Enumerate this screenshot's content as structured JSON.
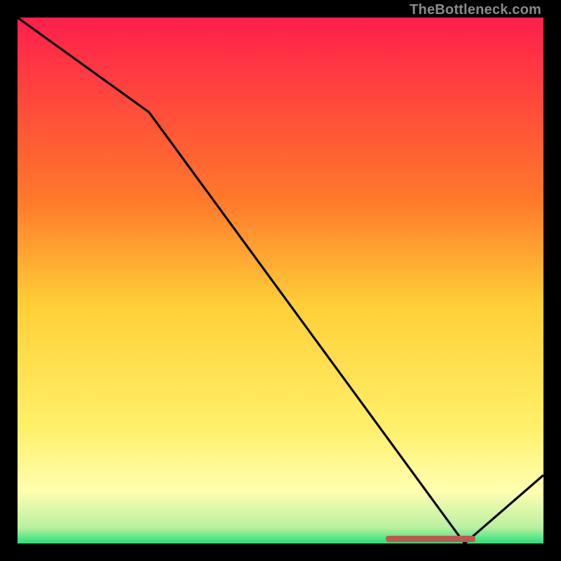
{
  "watermark": "TheBottleneck.com",
  "colors": {
    "bg": "#000000",
    "grad_top": "#ff1f4b",
    "grad_mid_upper": "#ff7a2a",
    "grad_mid": "#ffd038",
    "grad_mid_lower": "#fff06a",
    "grad_pale": "#ffffb0",
    "grad_green": "#28e07a",
    "curve": "#000000",
    "marker": "#c1584e"
  },
  "chart_data": {
    "type": "line",
    "title": "",
    "xlabel": "",
    "ylabel": "",
    "xlim": [
      0,
      100
    ],
    "ylim": [
      0,
      100
    ],
    "x": [
      0,
      25,
      85,
      100
    ],
    "values": [
      100,
      82,
      0,
      13
    ],
    "optimal_range_x": [
      70,
      87
    ],
    "gradient_stops": [
      {
        "pos": 0.0,
        "color": "#ff1f4b"
      },
      {
        "pos": 0.35,
        "color": "#ff7a2a"
      },
      {
        "pos": 0.55,
        "color": "#ffd038"
      },
      {
        "pos": 0.78,
        "color": "#fff06a"
      },
      {
        "pos": 0.9,
        "color": "#ffffb0"
      },
      {
        "pos": 0.97,
        "color": "#b8f0a0"
      },
      {
        "pos": 1.0,
        "color": "#28e07a"
      }
    ]
  }
}
